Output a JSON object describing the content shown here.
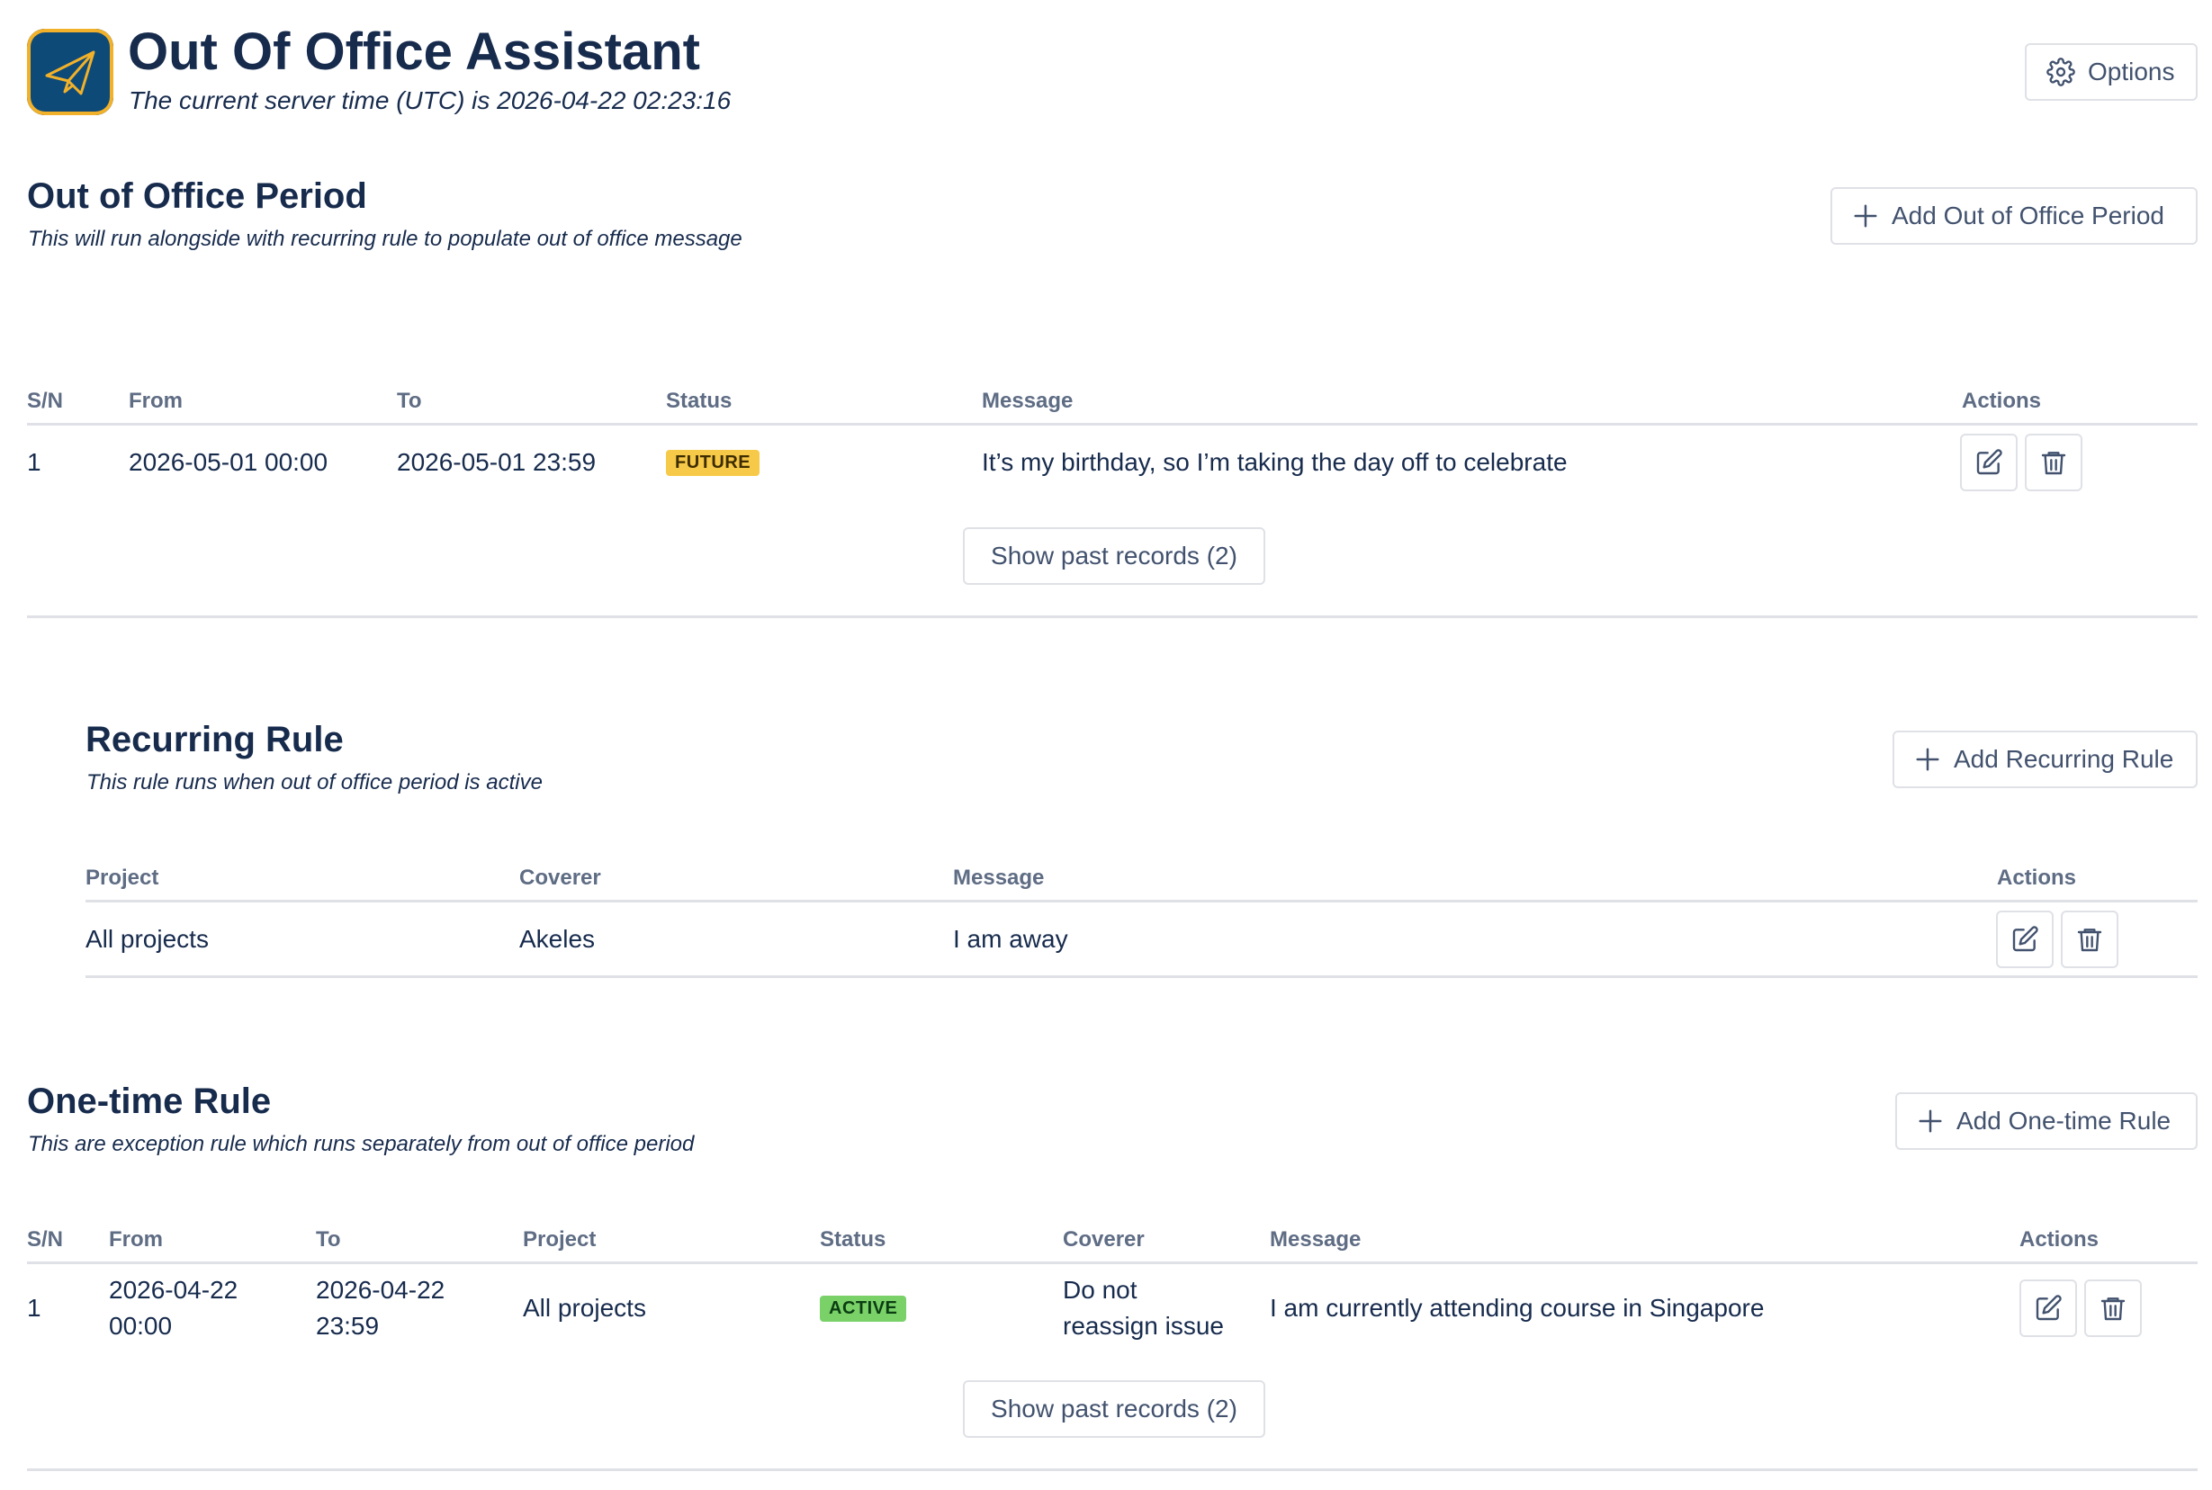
{
  "header": {
    "title": "Out Of Office Assistant",
    "server_time": "The current server time (UTC) is 2026-04-22 02:23:16",
    "options_label": "Options"
  },
  "ooo_period": {
    "title": "Out of Office Period",
    "subtitle": "This will run alongside with recurring rule to populate out of office message",
    "add_label": "Add Out of Office Period",
    "columns": [
      "S/N",
      "From",
      "To",
      "Status",
      "Message",
      "Actions"
    ],
    "rows": [
      {
        "sn": "1",
        "from": "2026-05-01 00:00",
        "to": "2026-05-01 23:59",
        "status": "FUTURE",
        "message": "It’s my birthday, so I’m taking the day off to celebrate"
      }
    ],
    "show_past_label": "Show past records (2)"
  },
  "recurring_rule": {
    "title": "Recurring Rule",
    "subtitle": "This rule runs when out of office period is active",
    "add_label": "Add Recurring Rule",
    "columns": [
      "Project",
      "Coverer",
      "Message",
      "Actions"
    ],
    "rows": [
      {
        "project": "All projects",
        "coverer": "Akeles",
        "message": "I am away"
      }
    ]
  },
  "onetime_rule": {
    "title": "One-time Rule",
    "subtitle": "This are exception rule which runs separately from out of office period",
    "add_label": "Add One-time Rule",
    "columns": [
      "S/N",
      "From",
      "To",
      "Project",
      "Status",
      "Coverer",
      "Message",
      "Actions"
    ],
    "rows": [
      {
        "sn": "1",
        "from_date": "2026-04-22",
        "from_time": "00:00",
        "to_date": "2026-04-22",
        "to_time": "23:59",
        "project": "All projects",
        "status": "ACTIVE",
        "coverer_1": "Do not",
        "coverer_2": "reassign issue",
        "message": "I am currently attending course in Singapore"
      }
    ],
    "show_past_label": "Show past records (2)"
  },
  "colors": {
    "text": "#172b4d",
    "header_text": "#5e6c84",
    "border": "#dfe1e6",
    "future_badge": "#f7c948",
    "active_badge": "#79d168",
    "logo_bg": "#0e4a78",
    "logo_accent": "#f2b12a"
  },
  "icons": [
    "paper-plane-icon",
    "gear-icon",
    "plus-icon",
    "edit-icon",
    "trash-icon"
  ]
}
